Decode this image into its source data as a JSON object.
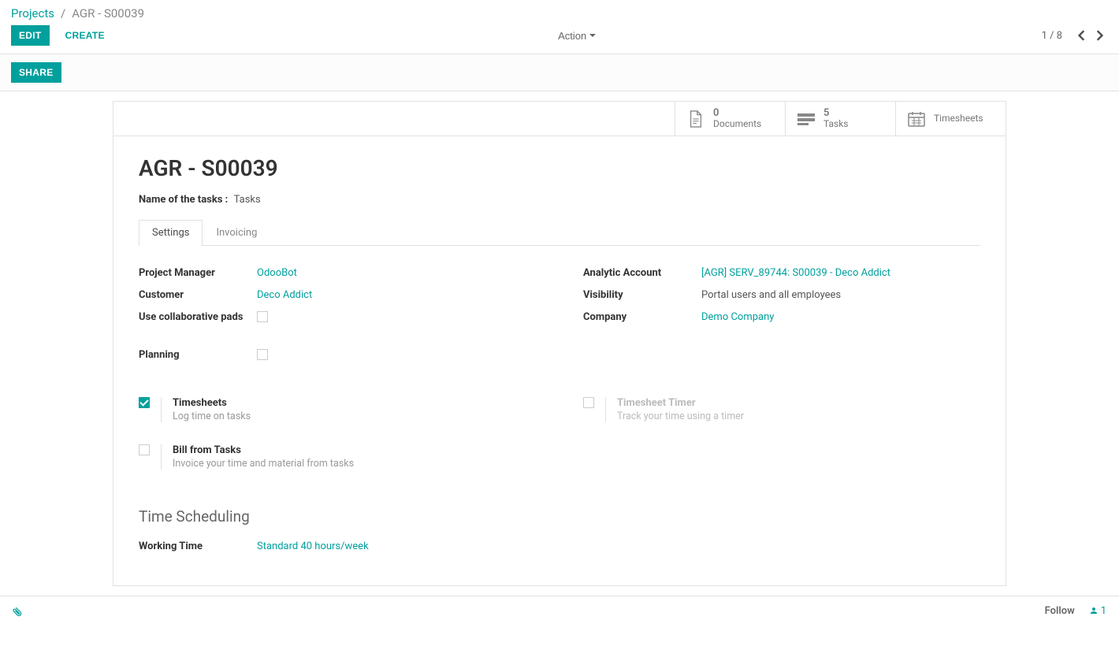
{
  "breadcrumb": {
    "root": "Projects",
    "current": "AGR - S00039"
  },
  "buttons": {
    "edit": "EDIT",
    "create": "CREATE",
    "share": "SHARE",
    "action": "Action",
    "follow": "Follow"
  },
  "pager": {
    "text": "1 / 8"
  },
  "followers_count": "1",
  "stat_buttons": {
    "documents": {
      "count": "0",
      "label": "Documents"
    },
    "tasks": {
      "count": "5",
      "label": "Tasks"
    },
    "timesheets": {
      "label": "Timesheets"
    }
  },
  "record": {
    "title": "AGR - S00039",
    "tasks_label": "Name of the tasks :",
    "tasks_value": "Tasks"
  },
  "tabs": {
    "settings": "Settings",
    "invoicing": "Invoicing"
  },
  "settings": {
    "left": {
      "project_manager_label": "Project Manager",
      "project_manager_value": "OdooBot",
      "customer_label": "Customer",
      "customer_value": "Deco Addict",
      "collab_pads_label": "Use collaborative pads",
      "planning_label": "Planning"
    },
    "right": {
      "analytic_label": "Analytic Account",
      "analytic_value": "[AGR] SERV_89744: S00039 - Deco Addict",
      "visibility_label": "Visibility",
      "visibility_value": "Portal users and all employees",
      "company_label": "Company",
      "company_value": "Demo Company"
    }
  },
  "features": {
    "timesheets": {
      "title": "Timesheets",
      "desc": "Log time on tasks"
    },
    "timer": {
      "title": "Timesheet Timer",
      "desc": "Track your time using a timer"
    },
    "bill": {
      "title": "Bill from Tasks",
      "desc": "Invoice your time and material from tasks"
    }
  },
  "scheduling": {
    "heading": "Time Scheduling",
    "working_time_label": "Working Time",
    "working_time_value": "Standard 40 hours/week"
  }
}
